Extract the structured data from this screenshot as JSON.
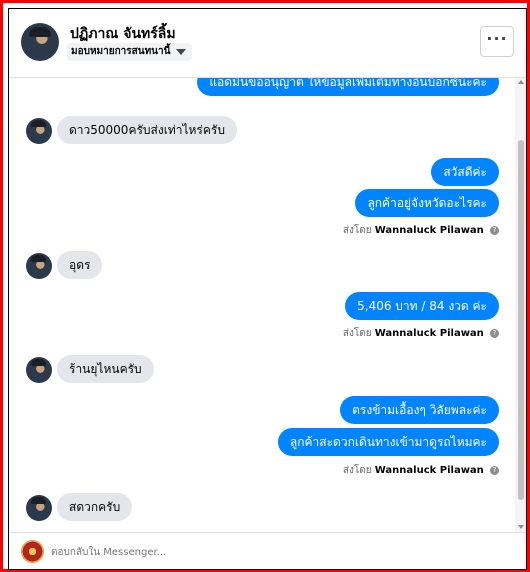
{
  "header": {
    "contact_name": "ปฏิภาณ จันทร์ลิ้ม",
    "assign_label": "มอบหมายการสนทนานี้",
    "more_label": "···"
  },
  "messages": [
    {
      "dir": "out",
      "text": "แอดมินขออนุญาต ให้ข้อมูลเพิ่มเติมทางอินบ็อกซ์นะคะ"
    },
    {
      "dir": "in",
      "text": "ดาว50000ครับส่งเท่าไหร่ครับ"
    },
    {
      "dir": "out",
      "text": "สวัสดีค่ะ"
    },
    {
      "dir": "out",
      "text": "ลูกค้าอยู่จังหวัดอะไรคะ"
    },
    {
      "dir": "in",
      "text": "อุดร"
    },
    {
      "dir": "out",
      "text": "5,406 บาท  / 84 งวด  ค่ะ"
    },
    {
      "dir": "in",
      "text": "ร้านยุไหนครับ"
    },
    {
      "dir": "out",
      "text": "ตรงข้ามเอื้องๆ  วิลัยพละค่ะ"
    },
    {
      "dir": "out",
      "text": "ลูกค้าสะดวกเดินทางเข้ามาดูรถไหมคะ"
    },
    {
      "dir": "in",
      "text": "สดวกครับ"
    }
  ],
  "sent_by": {
    "prefix": "ส่งโดย",
    "name": "Wannaluck Pilawan",
    "info_glyph": "?"
  },
  "composer": {
    "placeholder": "ตอบกลับใน Messenger..."
  },
  "colors": {
    "accent": "#0084ff",
    "incoming_bubble": "#e4e6eb",
    "frame": "#ff0000"
  },
  "icons": [
    "chevron-down-icon",
    "more-options-icon",
    "info-icon",
    "scroll-up-icon",
    "scroll-down-icon"
  ]
}
